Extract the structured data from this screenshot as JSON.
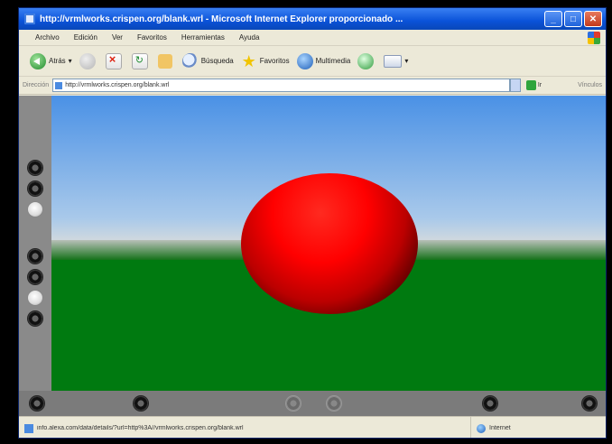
{
  "window": {
    "title": "http://vrmlworks.crispen.org/blank.wrl - Microsoft Internet Explorer proporcionado ...",
    "buttons": [
      "minimize",
      "maximize",
      "close"
    ]
  },
  "menu": [
    "Archivo",
    "Edición",
    "Ver",
    "Favoritos",
    "Herramientas",
    "Ayuda"
  ],
  "toolbar": {
    "back_label": "Atrás",
    "search_label": "Búsqueda",
    "favorites_label": "Favoritos",
    "media_label": "Multimedia"
  },
  "address": {
    "label": "Dirección",
    "value": "http://vrmlworks.crispen.org/blank.wrl",
    "go_label": "Ir",
    "links_label": "Vínculos"
  },
  "vrml": {
    "sphere_color": "#ff0000",
    "sky_color": "#4a91e6",
    "ground_color": "#007a10"
  },
  "status": {
    "text": "info.alexa.com/data/details/?url=http%3A//vrmlworks.crispen.org/blank.wrl",
    "zone": "Internet"
  }
}
